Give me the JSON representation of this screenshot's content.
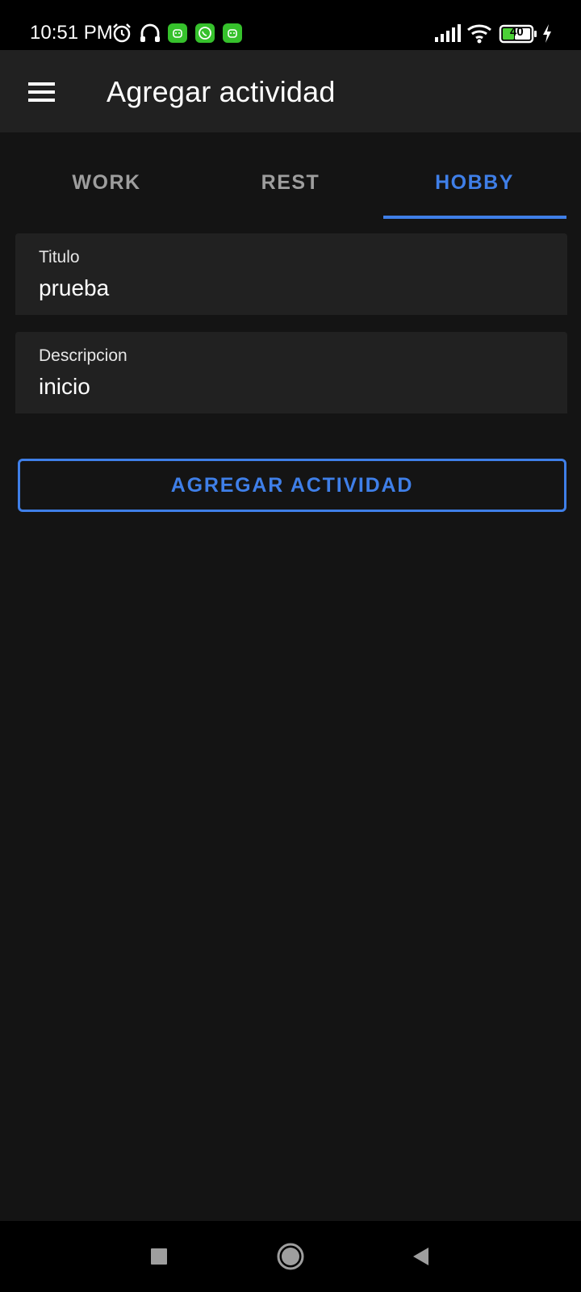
{
  "status_bar": {
    "time": "10:51 PM",
    "battery_level": "40",
    "icons": [
      "alarm-icon",
      "headphones-icon",
      "android-app-icon",
      "whatsapp-icon",
      "android-app-icon",
      "signal-icon",
      "wifi-icon",
      "battery-icon",
      "charging-icon"
    ]
  },
  "app_bar": {
    "title": "Agregar actividad",
    "menu_icon": "menu-icon"
  },
  "tabs": [
    {
      "label": "WORK",
      "selected": false
    },
    {
      "label": "REST",
      "selected": false
    },
    {
      "label": "HOBBY",
      "selected": true
    }
  ],
  "form": {
    "title_field": {
      "label": "Titulo",
      "value": "prueba"
    },
    "description_field": {
      "label": "Descripcion",
      "value": "inicio"
    },
    "submit_label": "AGREGAR ACTIVIDAD"
  },
  "nav_bar": {
    "buttons": [
      "recents-icon",
      "home-icon",
      "back-icon"
    ]
  },
  "colors": {
    "accent": "#3f7fe8",
    "background": "#141414",
    "surface": "#212121",
    "inactive_tab": "#9e9e9e"
  }
}
